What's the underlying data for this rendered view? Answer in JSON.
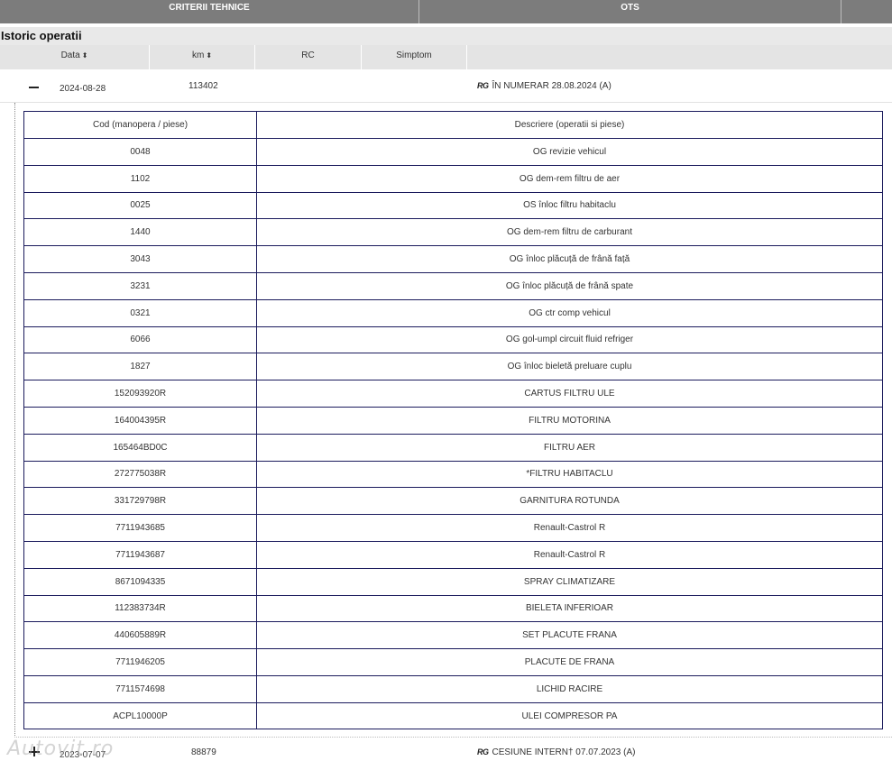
{
  "tabs": [
    {
      "label": "CRITERII TEHNICE"
    },
    {
      "label": "OTS"
    },
    {
      "label": ""
    }
  ],
  "section_title": "Istoric operatii",
  "columns": {
    "date": "Data",
    "km": "km",
    "rc": "RC",
    "symptom": "Simptom",
    "sort_icon": "⬍"
  },
  "records": [
    {
      "date": "2024-08-28",
      "km": "113402",
      "rg": "RG",
      "description": "ÎN NUMERAR 28.08.2024 (A)"
    },
    {
      "date": "2023-07-07",
      "km": "88879",
      "rg": "RG",
      "description": "CESIUNE INTERN† 07.07.2023 (A)"
    }
  ],
  "detail_table": {
    "header": {
      "code": "Cod (manopera / piese)",
      "description": "Descriere (operatii si piese)"
    },
    "rows": [
      {
        "code": "0048",
        "description": "OG revizie vehicul"
      },
      {
        "code": "1102",
        "description": "OG dem-rem filtru de aer"
      },
      {
        "code": "0025",
        "description": "OS înloc filtru habitaclu"
      },
      {
        "code": "1440",
        "description": "OG dem-rem filtru de carburant"
      },
      {
        "code": "3043",
        "description": "OG înloc plăcuță de frână față"
      },
      {
        "code": "3231",
        "description": "OG înloc plăcuță de frână spate"
      },
      {
        "code": "0321",
        "description": "OG ctr comp vehicul"
      },
      {
        "code": "6066",
        "description": "OG gol-umpl circuit fluid refriger"
      },
      {
        "code": "1827",
        "description": "OG înloc bieletă preluare cuplu"
      },
      {
        "code": "152093920R",
        "description": "CARTUS FILTRU ULE"
      },
      {
        "code": "164004395R",
        "description": "FILTRU MOTORINA"
      },
      {
        "code": "165464BD0C",
        "description": "FILTRU AER"
      },
      {
        "code": "272775038R",
        "description": "*FILTRU HABITACLU"
      },
      {
        "code": "331729798R",
        "description": "GARNITURA ROTUNDA"
      },
      {
        "code": "7711943685",
        "description": "Renault-Castrol R"
      },
      {
        "code": "7711943687",
        "description": "Renault-Castrol R"
      },
      {
        "code": "8671094335",
        "description": "SPRAY CLIMATIZARE"
      },
      {
        "code": "112383734R",
        "description": "BIELETA INFERIOAR"
      },
      {
        "code": "440605889R",
        "description": "SET PLACUTE FRANA"
      },
      {
        "code": "7711946205",
        "description": "PLACUTE DE FRANA"
      },
      {
        "code": "7711574698",
        "description": "LICHID RACIRE"
      },
      {
        "code": "ACPL10000P",
        "description": "ULEI COMPRESOR PA"
      }
    ]
  },
  "watermark": "Autovit.ro",
  "colors": {
    "tabbar": "#7c7c7c",
    "header_bg": "#e4e4e4",
    "table_border": "#1a1a5c"
  }
}
